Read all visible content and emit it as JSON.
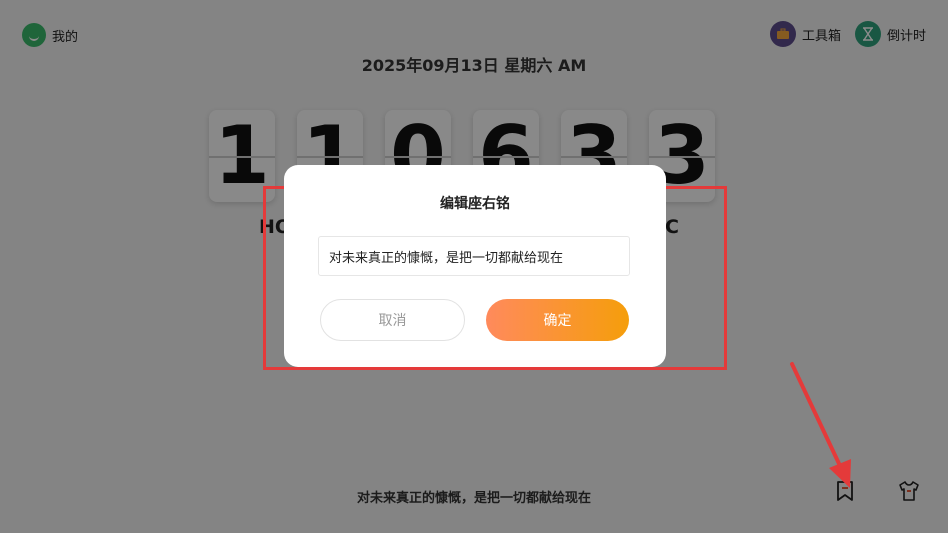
{
  "top": {
    "mine_label": "我的",
    "tools": [
      {
        "icon": "toolbox-icon",
        "label": "工具箱"
      },
      {
        "icon": "hourglass-icon",
        "label": "倒计时"
      }
    ]
  },
  "date": "2025年09月13日 星期六 AM",
  "clock": {
    "digits": [
      "1",
      "1",
      "0",
      "6",
      "3",
      "3"
    ],
    "unit_left": "HO",
    "unit_right": "C"
  },
  "motto": "对未来真正的慷慨，是把一切都献给现在",
  "dialog": {
    "title": "编辑座右铭",
    "input_value": "对未来真正的慷慨，是把一切都献给现在",
    "cancel_label": "取消",
    "confirm_label": "确定"
  },
  "annotation_color": "#e43a3a"
}
